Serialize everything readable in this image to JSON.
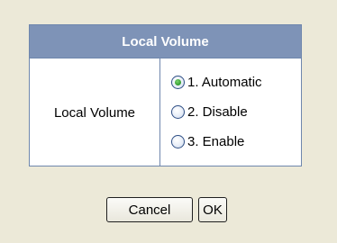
{
  "panel": {
    "title": "Local Volume",
    "row_label": "Local Volume",
    "options": [
      {
        "label": "1. Automatic",
        "checked": true
      },
      {
        "label": "2. Disable",
        "checked": false
      },
      {
        "label": "3. Enable",
        "checked": false
      }
    ]
  },
  "buttons": {
    "cancel_label": "Cancel",
    "ok_label": "OK"
  },
  "colors": {
    "page_background": "#ece9d8",
    "header_background": "#7e93b7",
    "border": "#6f87ad",
    "radio_selected": "#2f9a2d"
  }
}
